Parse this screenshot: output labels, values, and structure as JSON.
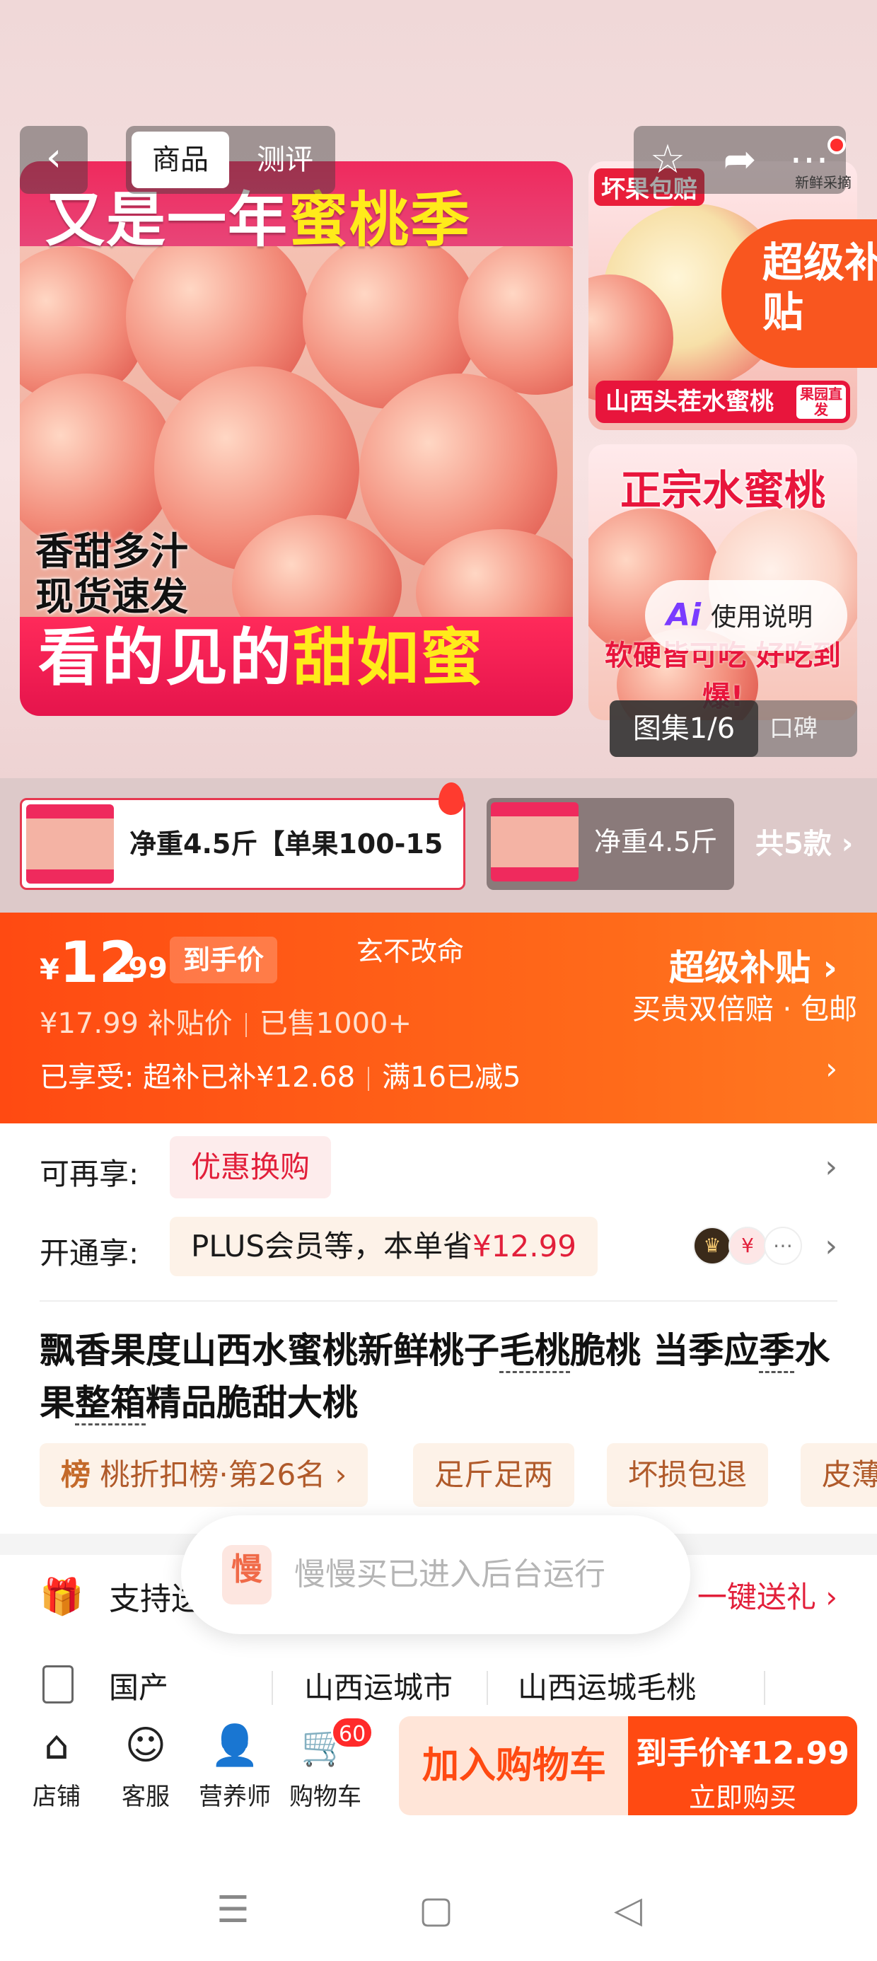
{
  "nav": {
    "tab_active": "商品",
    "tab_other": "测评"
  },
  "gallery": {
    "main_title_white": "又是一年",
    "main_title_yellow": "蜜桃季",
    "main_side_1": "香甜多汁",
    "main_side_2": "现货速发",
    "main_bottom_white": "看的见的",
    "main_bottom_yellow": "甜如蜜",
    "side1_tag": "坏果包赔",
    "side1_tag2": "新鲜采摘",
    "side1_bottom": "山西头茬水蜜桃",
    "side1_box": "果园直发",
    "super_sub": "超级补贴",
    "side2_title": "正宗水蜜桃",
    "side2_bottom": "软硬皆可吃 好吃到爆!",
    "ai_label": "使用说明",
    "pager_on": "图集1/6",
    "pager_off": "口碑"
  },
  "variants": {
    "v1": "净重4.5斤【单果100-15",
    "v2": "净重4.5斤",
    "count": "共5款 ›"
  },
  "price": {
    "yen": "¥",
    "int": "12",
    "dec": ".99",
    "tag": "到手价",
    "shop": "玄不改命",
    "super": "超级补贴 ›",
    "super_sub": "买贵双倍赔 · 包邮",
    "orig": "¥17.99 补贴价",
    "sold": "已售1000+",
    "enjoy_a": "已享受: 超补已补¥12.68",
    "enjoy_b": "满16已减5"
  },
  "promos": {
    "label1": "可再享:",
    "chip1": "优惠换购",
    "label2": "开通享:",
    "chip2_a": "PLUS会员等，本单省",
    "chip2_b": "¥12.99"
  },
  "product": {
    "title_1": "飘香果度山西水蜜桃新鲜桃子",
    "kw1": "毛桃",
    "title_2": "脆桃 当季应",
    "kw2": "季",
    "title_3": "水果",
    "kw3": "整箱",
    "title_4": "精品脆甜大桃"
  },
  "tags": {
    "rank_icon": "榜",
    "rank": "桃折扣榜·第26名 ›",
    "t2": "足斤足两",
    "t3": "坏损包退",
    "t4": "皮薄"
  },
  "gift": {
    "text": "支持送",
    "right": "一键送礼 ›"
  },
  "specs": {
    "s1": "国产",
    "s2": "山西运城市",
    "s3": "山西运城毛桃"
  },
  "toast": {
    "icon": "慢",
    "text": "慢慢买已进入后台运行"
  },
  "bottom": {
    "shop": "店铺",
    "service": "客服",
    "nutri": "营养师",
    "cart": "购物车",
    "badge": "60",
    "add_cart": "加入购物车",
    "buy_price": "到手价¥12.99",
    "buy_now": "立即购买"
  },
  "colors": {
    "accent": "#ff4a12",
    "red": "#e21f3a"
  }
}
